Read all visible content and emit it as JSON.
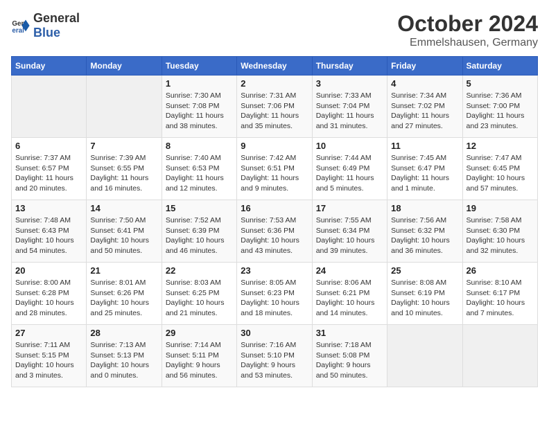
{
  "header": {
    "logo_general": "General",
    "logo_blue": "Blue",
    "month": "October 2024",
    "location": "Emmelshausen, Germany"
  },
  "weekdays": [
    "Sunday",
    "Monday",
    "Tuesday",
    "Wednesday",
    "Thursday",
    "Friday",
    "Saturday"
  ],
  "weeks": [
    [
      {
        "day": "",
        "sunrise": "",
        "sunset": "",
        "daylight": ""
      },
      {
        "day": "",
        "sunrise": "",
        "sunset": "",
        "daylight": ""
      },
      {
        "day": "1",
        "sunrise": "Sunrise: 7:30 AM",
        "sunset": "Sunset: 7:08 PM",
        "daylight": "Daylight: 11 hours and 38 minutes."
      },
      {
        "day": "2",
        "sunrise": "Sunrise: 7:31 AM",
        "sunset": "Sunset: 7:06 PM",
        "daylight": "Daylight: 11 hours and 35 minutes."
      },
      {
        "day": "3",
        "sunrise": "Sunrise: 7:33 AM",
        "sunset": "Sunset: 7:04 PM",
        "daylight": "Daylight: 11 hours and 31 minutes."
      },
      {
        "day": "4",
        "sunrise": "Sunrise: 7:34 AM",
        "sunset": "Sunset: 7:02 PM",
        "daylight": "Daylight: 11 hours and 27 minutes."
      },
      {
        "day": "5",
        "sunrise": "Sunrise: 7:36 AM",
        "sunset": "Sunset: 7:00 PM",
        "daylight": "Daylight: 11 hours and 23 minutes."
      }
    ],
    [
      {
        "day": "6",
        "sunrise": "Sunrise: 7:37 AM",
        "sunset": "Sunset: 6:57 PM",
        "daylight": "Daylight: 11 hours and 20 minutes."
      },
      {
        "day": "7",
        "sunrise": "Sunrise: 7:39 AM",
        "sunset": "Sunset: 6:55 PM",
        "daylight": "Daylight: 11 hours and 16 minutes."
      },
      {
        "day": "8",
        "sunrise": "Sunrise: 7:40 AM",
        "sunset": "Sunset: 6:53 PM",
        "daylight": "Daylight: 11 hours and 12 minutes."
      },
      {
        "day": "9",
        "sunrise": "Sunrise: 7:42 AM",
        "sunset": "Sunset: 6:51 PM",
        "daylight": "Daylight: 11 hours and 9 minutes."
      },
      {
        "day": "10",
        "sunrise": "Sunrise: 7:44 AM",
        "sunset": "Sunset: 6:49 PM",
        "daylight": "Daylight: 11 hours and 5 minutes."
      },
      {
        "day": "11",
        "sunrise": "Sunrise: 7:45 AM",
        "sunset": "Sunset: 6:47 PM",
        "daylight": "Daylight: 11 hours and 1 minute."
      },
      {
        "day": "12",
        "sunrise": "Sunrise: 7:47 AM",
        "sunset": "Sunset: 6:45 PM",
        "daylight": "Daylight: 10 hours and 57 minutes."
      }
    ],
    [
      {
        "day": "13",
        "sunrise": "Sunrise: 7:48 AM",
        "sunset": "Sunset: 6:43 PM",
        "daylight": "Daylight: 10 hours and 54 minutes."
      },
      {
        "day": "14",
        "sunrise": "Sunrise: 7:50 AM",
        "sunset": "Sunset: 6:41 PM",
        "daylight": "Daylight: 10 hours and 50 minutes."
      },
      {
        "day": "15",
        "sunrise": "Sunrise: 7:52 AM",
        "sunset": "Sunset: 6:39 PM",
        "daylight": "Daylight: 10 hours and 46 minutes."
      },
      {
        "day": "16",
        "sunrise": "Sunrise: 7:53 AM",
        "sunset": "Sunset: 6:36 PM",
        "daylight": "Daylight: 10 hours and 43 minutes."
      },
      {
        "day": "17",
        "sunrise": "Sunrise: 7:55 AM",
        "sunset": "Sunset: 6:34 PM",
        "daylight": "Daylight: 10 hours and 39 minutes."
      },
      {
        "day": "18",
        "sunrise": "Sunrise: 7:56 AM",
        "sunset": "Sunset: 6:32 PM",
        "daylight": "Daylight: 10 hours and 36 minutes."
      },
      {
        "day": "19",
        "sunrise": "Sunrise: 7:58 AM",
        "sunset": "Sunset: 6:30 PM",
        "daylight": "Daylight: 10 hours and 32 minutes."
      }
    ],
    [
      {
        "day": "20",
        "sunrise": "Sunrise: 8:00 AM",
        "sunset": "Sunset: 6:28 PM",
        "daylight": "Daylight: 10 hours and 28 minutes."
      },
      {
        "day": "21",
        "sunrise": "Sunrise: 8:01 AM",
        "sunset": "Sunset: 6:26 PM",
        "daylight": "Daylight: 10 hours and 25 minutes."
      },
      {
        "day": "22",
        "sunrise": "Sunrise: 8:03 AM",
        "sunset": "Sunset: 6:25 PM",
        "daylight": "Daylight: 10 hours and 21 minutes."
      },
      {
        "day": "23",
        "sunrise": "Sunrise: 8:05 AM",
        "sunset": "Sunset: 6:23 PM",
        "daylight": "Daylight: 10 hours and 18 minutes."
      },
      {
        "day": "24",
        "sunrise": "Sunrise: 8:06 AM",
        "sunset": "Sunset: 6:21 PM",
        "daylight": "Daylight: 10 hours and 14 minutes."
      },
      {
        "day": "25",
        "sunrise": "Sunrise: 8:08 AM",
        "sunset": "Sunset: 6:19 PM",
        "daylight": "Daylight: 10 hours and 10 minutes."
      },
      {
        "day": "26",
        "sunrise": "Sunrise: 8:10 AM",
        "sunset": "Sunset: 6:17 PM",
        "daylight": "Daylight: 10 hours and 7 minutes."
      }
    ],
    [
      {
        "day": "27",
        "sunrise": "Sunrise: 7:11 AM",
        "sunset": "Sunset: 5:15 PM",
        "daylight": "Daylight: 10 hours and 3 minutes."
      },
      {
        "day": "28",
        "sunrise": "Sunrise: 7:13 AM",
        "sunset": "Sunset: 5:13 PM",
        "daylight": "Daylight: 10 hours and 0 minutes."
      },
      {
        "day": "29",
        "sunrise": "Sunrise: 7:14 AM",
        "sunset": "Sunset: 5:11 PM",
        "daylight": "Daylight: 9 hours and 56 minutes."
      },
      {
        "day": "30",
        "sunrise": "Sunrise: 7:16 AM",
        "sunset": "Sunset: 5:10 PM",
        "daylight": "Daylight: 9 hours and 53 minutes."
      },
      {
        "day": "31",
        "sunrise": "Sunrise: 7:18 AM",
        "sunset": "Sunset: 5:08 PM",
        "daylight": "Daylight: 9 hours and 50 minutes."
      },
      {
        "day": "",
        "sunrise": "",
        "sunset": "",
        "daylight": ""
      },
      {
        "day": "",
        "sunrise": "",
        "sunset": "",
        "daylight": ""
      }
    ]
  ]
}
